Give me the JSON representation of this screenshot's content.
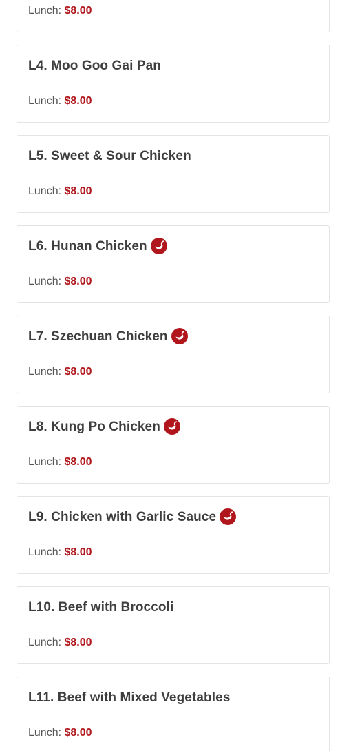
{
  "accent_color": "#b0161b",
  "first_price": {
    "label": "Lunch:",
    "price": "$8.00"
  },
  "items": [
    {
      "title": "L4. Moo Goo Gai Pan",
      "price_label": "Lunch:",
      "price": "$8.00",
      "spicy": false
    },
    {
      "title": "L5. Sweet & Sour Chicken",
      "price_label": "Lunch:",
      "price": "$8.00",
      "spicy": false
    },
    {
      "title": "L6. Hunan Chicken",
      "price_label": "Lunch:",
      "price": "$8.00",
      "spicy": true,
      "icon": "spicy-pepper-icon"
    },
    {
      "title": "L7. Szechuan Chicken",
      "price_label": "Lunch:",
      "price": "$8.00",
      "spicy": true,
      "icon": "spicy-pepper-icon"
    },
    {
      "title": "L8. Kung Po Chicken",
      "price_label": "Lunch:",
      "price": "$8.00",
      "spicy": true,
      "icon": "spicy-pepper-icon"
    },
    {
      "title": "L9. Chicken with Garlic Sauce",
      "price_label": "Lunch:",
      "price": "$8.00",
      "spicy": true,
      "icon": "spicy-pepper-icon"
    },
    {
      "title": "L10. Beef with Broccoli",
      "price_label": "Lunch:",
      "price": "$8.00",
      "spicy": false
    },
    {
      "title": "L11. Beef with Mixed Vegetables",
      "price_label": "Lunch:",
      "price": "$8.00",
      "spicy": false
    }
  ]
}
